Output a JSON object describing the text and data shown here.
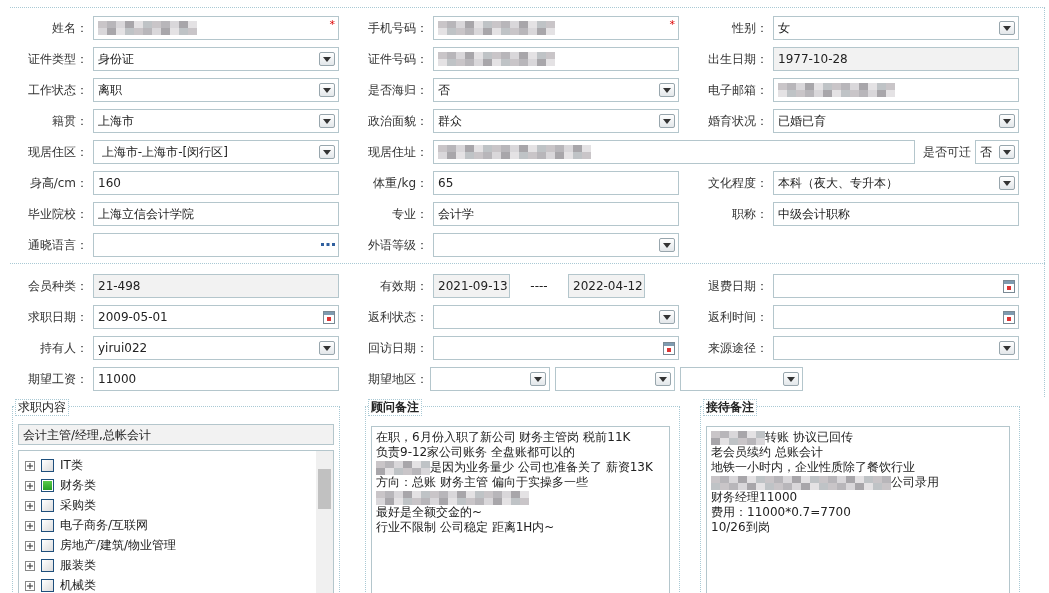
{
  "basic_info": {
    "fields": [
      {
        "label": "姓名：",
        "kind": "text",
        "redacted": true,
        "required_mark": "*"
      },
      {
        "label": "手机号码：",
        "kind": "text",
        "redacted": true,
        "required_mark": "*"
      },
      {
        "label": "性别：",
        "kind": "select",
        "value": "女"
      },
      {
        "label": "证件类型：",
        "kind": "select",
        "value": "身份证"
      },
      {
        "label": "证件号码：",
        "kind": "text",
        "redacted": true
      },
      {
        "label": "出生日期：",
        "kind": "readonly",
        "value": "1977-10-28"
      },
      {
        "label": "工作状态：",
        "kind": "select",
        "value": "离职"
      },
      {
        "label": "是否海归：",
        "kind": "select",
        "value": "否"
      },
      {
        "label": "电子邮箱：",
        "kind": "text",
        "redacted": true
      },
      {
        "label": "籍贯：",
        "kind": "select",
        "value": "上海市"
      },
      {
        "label": "政治面貌：",
        "kind": "select",
        "value": "群众"
      },
      {
        "label": "婚育状况：",
        "kind": "select",
        "value": "已婚已育"
      },
      {
        "label": "现居住区：",
        "kind": "select",
        "value": " 上海市-上海市-[闵行区]"
      },
      {
        "label": "现居住址：",
        "kind": "address",
        "redacted": true,
        "relocatable": {
          "label": "是否可迁",
          "value": "否"
        }
      },
      {
        "label": "身高/cm：",
        "kind": "text",
        "value": "160"
      },
      {
        "label": "体重/kg：",
        "kind": "text",
        "value": "65"
      },
      {
        "label": "文化程度：",
        "kind": "select",
        "value": "本科（夜大、专升本）"
      },
      {
        "label": "毕业院校：",
        "kind": "text",
        "value": "上海立信会计学院"
      },
      {
        "label": "专业：",
        "kind": "text",
        "value": "会计学"
      },
      {
        "label": "职称：",
        "kind": "text",
        "value": "中级会计职称"
      },
      {
        "label": "通晓语言：",
        "kind": "lookup"
      },
      {
        "label": "外语等级：",
        "kind": "select"
      }
    ]
  },
  "membership": {
    "fields": [
      {
        "label": "会员种类：",
        "kind": "readonly",
        "value": "21-498"
      },
      {
        "label": "有效期：",
        "kind": "range",
        "values": [
          "2021-09-13",
          "2022-04-12"
        ],
        "separator": "----"
      },
      {
        "label": "退费日期：",
        "kind": "date"
      },
      {
        "label": "求职日期：",
        "kind": "date",
        "value": "2009-05-01"
      },
      {
        "label": "返利状态：",
        "kind": "select"
      },
      {
        "label": "返利时间：",
        "kind": "date"
      },
      {
        "label": "持有人：",
        "kind": "select",
        "value": "yirui022"
      },
      {
        "label": "回访日期：",
        "kind": "date"
      },
      {
        "label": "来源途径：",
        "kind": "select"
      },
      {
        "label": "期望工资：",
        "kind": "text",
        "value": "11000"
      },
      {
        "label": "期望地区：",
        "kind": "region"
      }
    ]
  },
  "job_intent": {
    "legend": "求职内容",
    "summary": "会计主管/经理,总帐会计",
    "categories": [
      {
        "label": "IT类",
        "checked": false,
        "expanded": false
      },
      {
        "label": "财务类",
        "checked": true,
        "expanded": false
      },
      {
        "label": "采购类",
        "checked": false,
        "expanded": false
      },
      {
        "label": "电子商务/互联网",
        "checked": false,
        "expanded": false
      },
      {
        "label": "房地产/建筑/物业管理",
        "checked": false,
        "expanded": false
      },
      {
        "label": "服装类",
        "checked": false,
        "expanded": false
      },
      {
        "label": "机械类",
        "checked": false,
        "expanded": false
      }
    ]
  },
  "consultant_notes": {
    "legend": "顾问备注",
    "lines": [
      {
        "kind": "text",
        "text": "在职，6月份入职了新公司 财务主管岗 税前11K"
      },
      {
        "kind": "text",
        "text": "负责9-12家公司账务 全盘账都可以的"
      },
      {
        "kind": "blurred-prefix",
        "text": "是因为业务量少 公司也准备关了 薪资13K"
      },
      {
        "kind": "text",
        "text": "方向：总账 财务主管 偏向于实操多一些"
      },
      {
        "kind": "blurred"
      },
      {
        "kind": "text",
        "text": "最好是全额交金的~"
      },
      {
        "kind": "text",
        "text": "行业不限制 公司稳定 距离1H内~"
      }
    ]
  },
  "reception_notes": {
    "legend": "接待备注",
    "lines": [
      {
        "kind": "blurred-prefix",
        "text": "转账 协议已回传"
      },
      {
        "kind": "text",
        "text": "老会员续约 总账会计"
      },
      {
        "kind": "text",
        "text": "地铁一小时内，企业性质除了餐饮行业"
      },
      {
        "kind": "blurred-prefix",
        "text": "公司录用"
      },
      {
        "kind": "text",
        "text": "财务经理11000"
      },
      {
        "kind": "text",
        "text": "费用：11000*0.7=7700"
      },
      {
        "kind": "text",
        "text": "10/26到岗"
      }
    ]
  }
}
